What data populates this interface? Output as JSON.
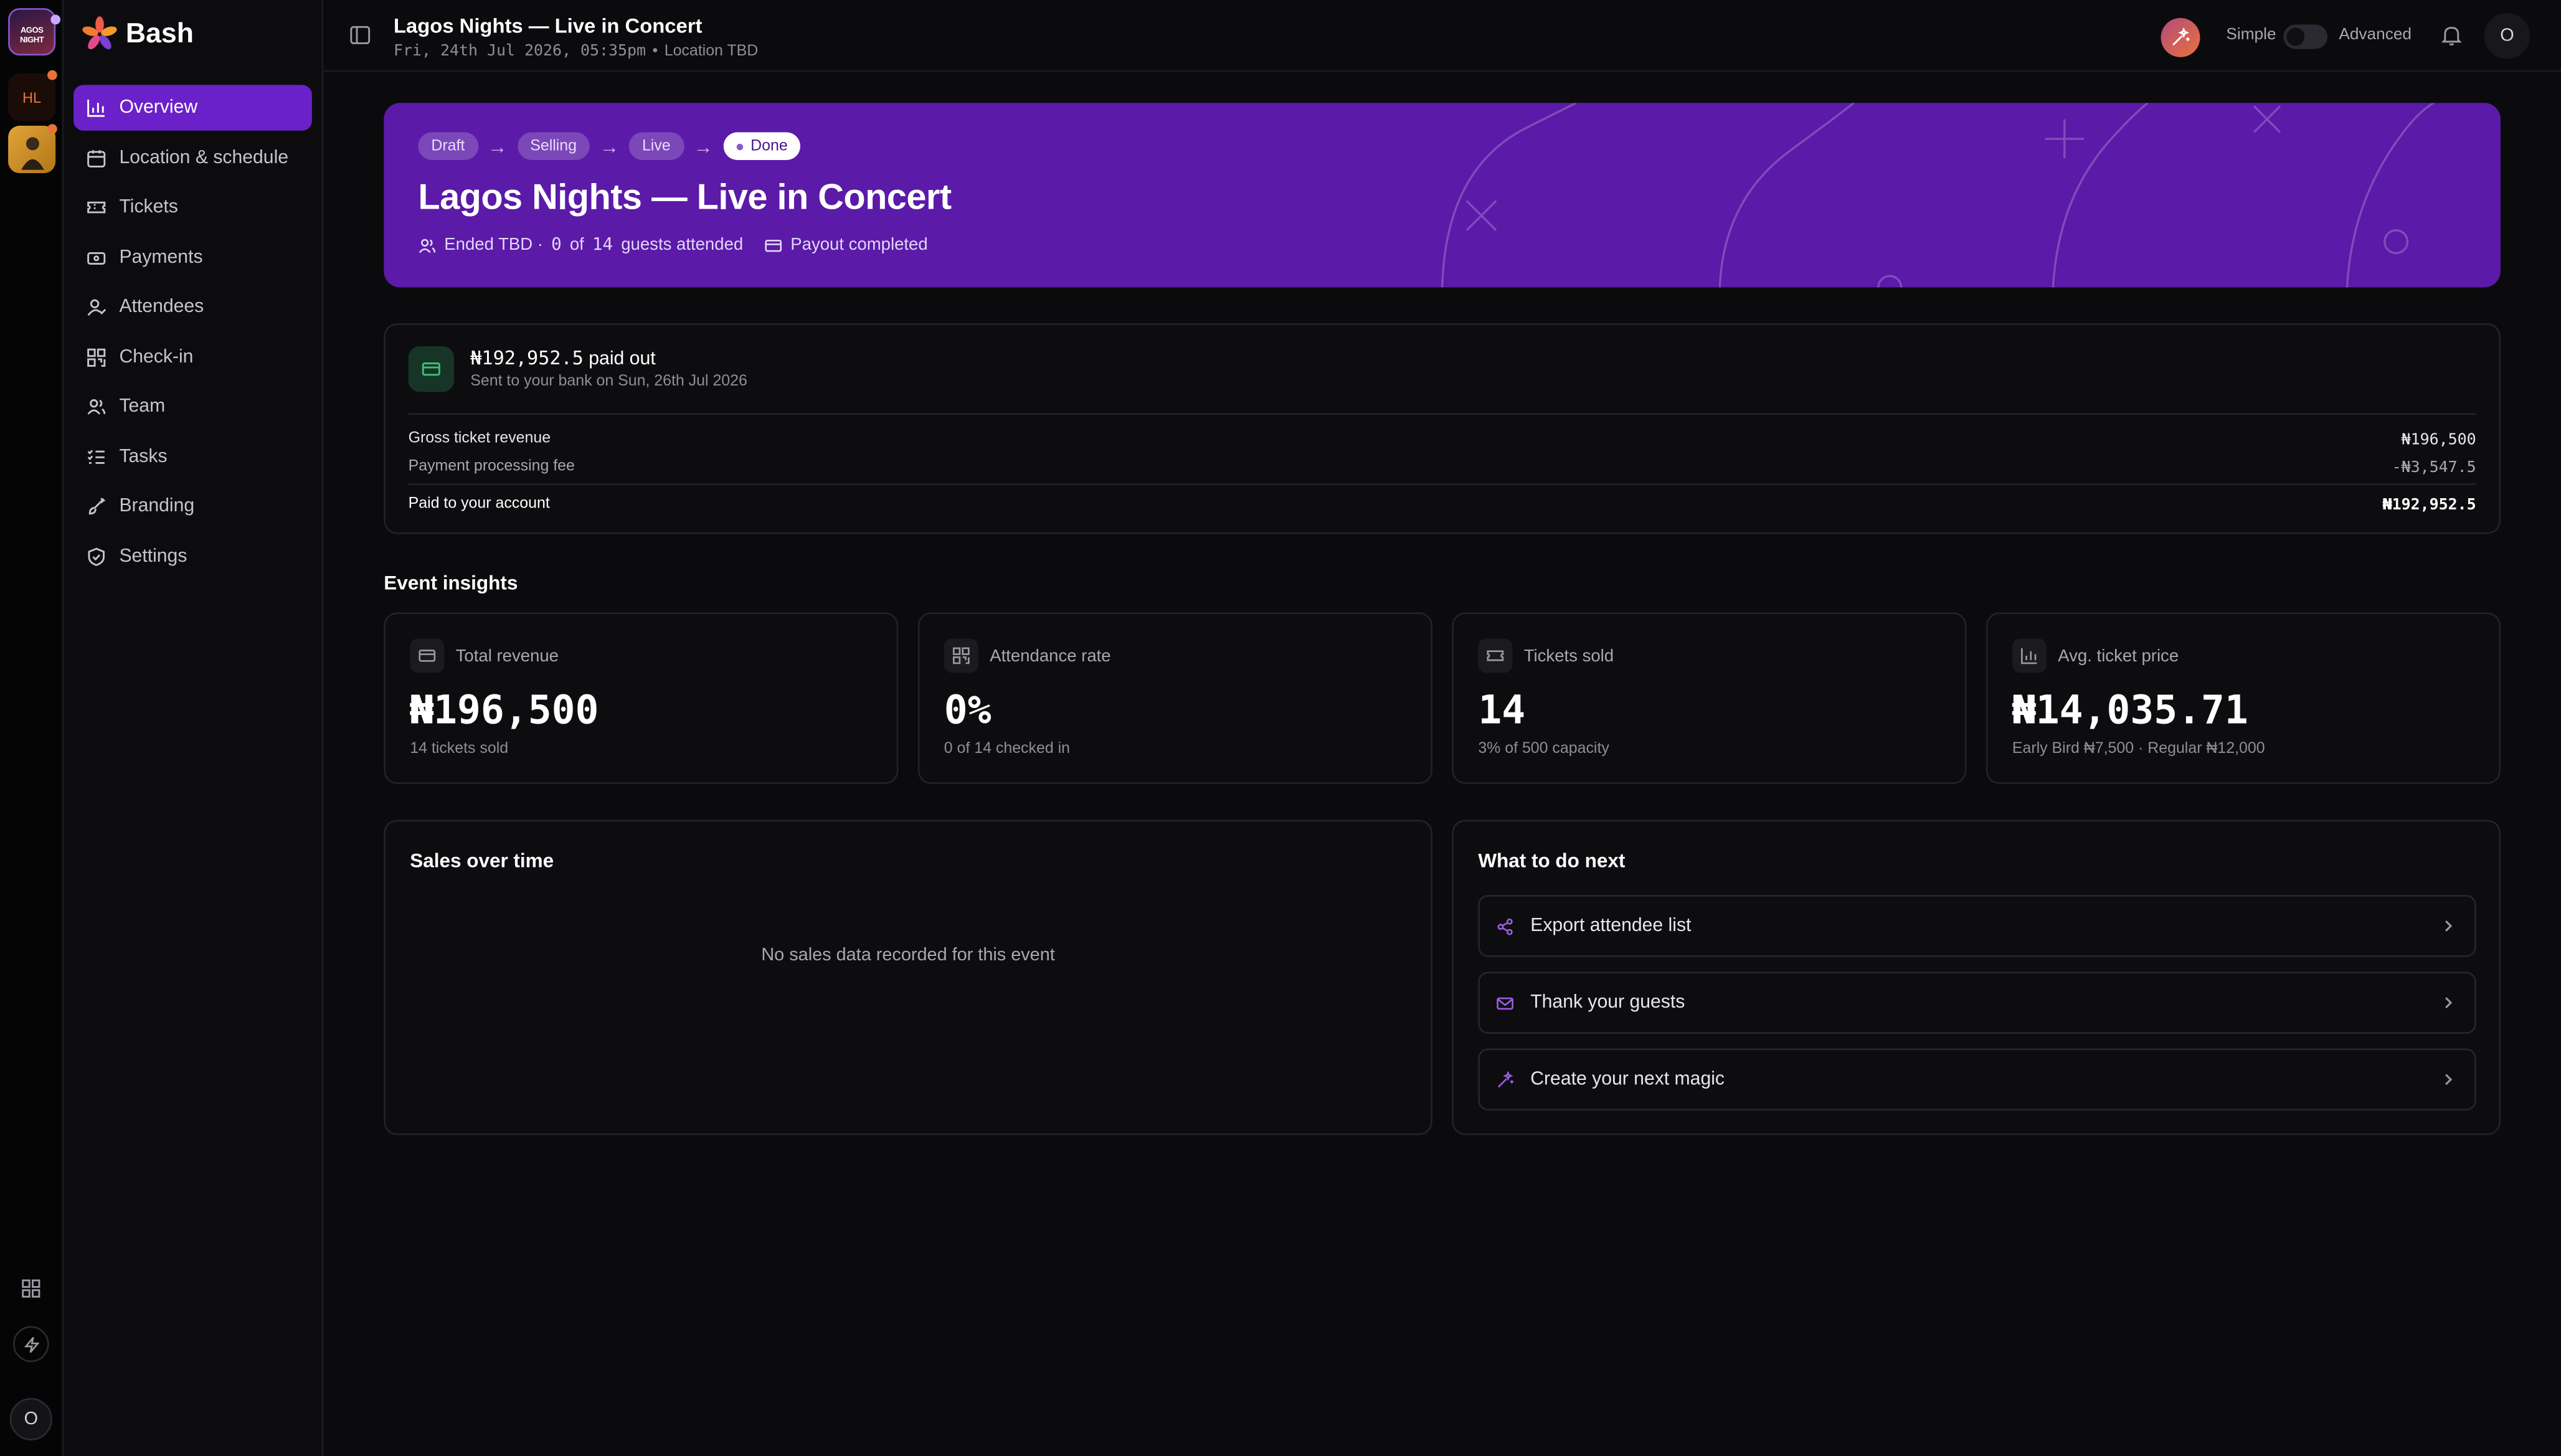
{
  "app": {
    "name": "Bash"
  },
  "rail": {
    "event_thumb_text": "AGOS NIGHT",
    "hl_initials": "HL",
    "user_initial": "O"
  },
  "sidebar": {
    "items": [
      {
        "label": "Overview",
        "icon": "bar-chart-icon",
        "active": true
      },
      {
        "label": "Location & schedule",
        "icon": "calendar-icon"
      },
      {
        "label": "Tickets",
        "icon": "ticket-icon"
      },
      {
        "label": "Payments",
        "icon": "payments-icon"
      },
      {
        "label": "Attendees",
        "icon": "user-check-icon"
      },
      {
        "label": "Check-in",
        "icon": "qr-code-icon"
      },
      {
        "label": "Team",
        "icon": "users-icon"
      },
      {
        "label": "Tasks",
        "icon": "checklist-icon"
      },
      {
        "label": "Branding",
        "icon": "brush-icon"
      },
      {
        "label": "Settings",
        "icon": "shield-icon"
      }
    ]
  },
  "header": {
    "title": "Lagos Nights — Live in Concert",
    "date": "Fri, 24th Jul 2026, 05:35pm",
    "separator": "•",
    "location": "Location TBD",
    "simple_label": "Simple",
    "advanced_label": "Advanced",
    "mode": "Simple",
    "avatar_initial": "O"
  },
  "hero": {
    "steps": [
      "Draft",
      "Selling",
      "Live",
      "Done"
    ],
    "current_step": "Done",
    "arrow": "→",
    "title": "Lagos Nights — Live in Concert",
    "ended": "Ended TBD ·",
    "attended_count": "0",
    "of_text": "of",
    "total_guests": "14",
    "guests_attended_text": "guests attended",
    "payout_status": "Payout completed"
  },
  "payout": {
    "amount": "₦192,952.5",
    "paid_out_text": "paid out",
    "sent_text": "Sent to your bank on Sun, 26th Jul 2026",
    "rows": [
      {
        "label": "Gross ticket revenue",
        "value": "₦196,500"
      },
      {
        "label": "Payment processing fee",
        "value": "-₦3,547.5"
      }
    ],
    "total_label": "Paid to your account",
    "total_value": "₦192,952.5"
  },
  "insights": {
    "title": "Event insights",
    "cards": [
      {
        "label": "Total revenue",
        "value": "₦196,500",
        "sub": "14 tickets sold",
        "icon": "credit-card-icon"
      },
      {
        "label": "Attendance rate",
        "value": "0%",
        "sub": "0 of 14 checked in",
        "icon": "qr-code-icon"
      },
      {
        "label": "Tickets sold",
        "value": "14",
        "sub": "3% of 500 capacity",
        "icon": "ticket-icon"
      },
      {
        "label": "Avg. ticket price",
        "value": "₦14,035.71",
        "sub": "Early Bird ₦7,500 · Regular ₦12,000",
        "icon": "bar-chart-icon"
      }
    ]
  },
  "sales": {
    "title": "Sales over time",
    "empty_text": "No sales data recorded for this event"
  },
  "next": {
    "title": "What to do next",
    "actions": [
      {
        "label": "Export attendee list",
        "icon": "share-icon"
      },
      {
        "label": "Thank your guests",
        "icon": "mail-icon"
      },
      {
        "label": "Create your next magic",
        "icon": "sparkles-icon"
      }
    ]
  },
  "colors": {
    "accent": "#6b21c9",
    "hero_bg": "#5b1aa8",
    "payout_icon_bg": "#173526",
    "payout_icon": "#3fbf76",
    "action_icon": "#9b5de5"
  }
}
